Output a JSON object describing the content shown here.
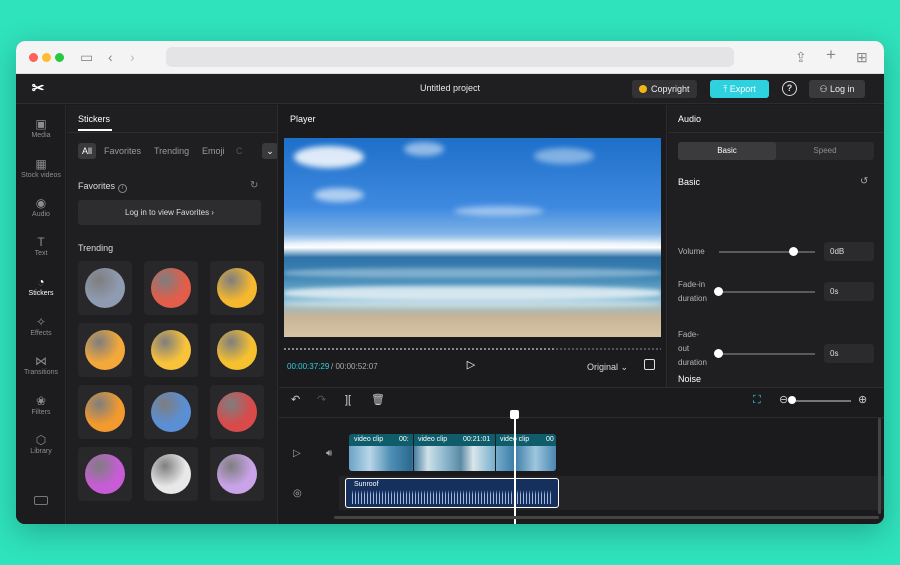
{
  "app": {
    "project_title": "Untitled project",
    "copyright_label": "Copyright",
    "export_label": "Export",
    "login_label": "Log in",
    "help_glyph": "?"
  },
  "nav": {
    "items": [
      {
        "label": "Media",
        "icon": "media-icon"
      },
      {
        "label": "Stock videos",
        "icon": "stock-videos-icon"
      },
      {
        "label": "Audio",
        "icon": "audio-icon"
      },
      {
        "label": "Text",
        "icon": "text-icon"
      },
      {
        "label": "Stickers",
        "icon": "stickers-icon"
      },
      {
        "label": "Effects",
        "icon": "effects-icon"
      },
      {
        "label": "Transitions",
        "icon": "transitions-icon"
      },
      {
        "label": "Filters",
        "icon": "filters-icon"
      },
      {
        "label": "Library",
        "icon": "library-icon"
      }
    ],
    "active": "Stickers"
  },
  "stickers": {
    "title": "Stickers",
    "tabs": [
      "All",
      "Favorites",
      "Trending",
      "Emoji",
      "C"
    ],
    "favorites_title": "Favorites",
    "favorites_login": "Log in to view Favorites ›",
    "trending_title": "Trending",
    "items": [
      {
        "name": "rain-cloud-sticker",
        "color": "#8e9bb0"
      },
      {
        "name": "angry-cloud-sticker",
        "color": "#e25d4a"
      },
      {
        "name": "smiling-sun-sticker",
        "color": "#f5b82e"
      },
      {
        "name": "heart-eyes-sticker",
        "color": "#f4a83a"
      },
      {
        "name": "laughing-tears-sticker",
        "color": "#f8c23a"
      },
      {
        "name": "winking-tongue-sticker",
        "color": "#f6c12f"
      },
      {
        "name": "angry-face-sticker",
        "color": "#f29a2e"
      },
      {
        "name": "video-window-sticker",
        "color": "#5a8fd6"
      },
      {
        "name": "calendar-hand-sticker",
        "color": "#d94a4a"
      },
      {
        "name": "party-popper-sticker",
        "color": "#c85cd6"
      },
      {
        "name": "megaphone-sticker",
        "color": "#e8e8e8"
      },
      {
        "name": "hearts-sticker",
        "color": "#c9a3e8"
      }
    ]
  },
  "player": {
    "title": "Player",
    "time_current": "00:00:37:29",
    "time_total": "/ 00:00:52:07",
    "progress": 0.72,
    "ratio_label": "Original ⌄"
  },
  "audio": {
    "title": "Audio",
    "tab_basic": "Basic",
    "tab_speed": "Speed",
    "section_basic": "Basic",
    "volume_label": "Volume",
    "volume_value": "0dB",
    "volume_level": 0.77,
    "fadein_label": "Fade-in duration",
    "fadein_value": "0s",
    "fadeout_label": "Fade-out duration",
    "fadeout_value": "0s",
    "section_noise": "Noise"
  },
  "timeline": {
    "video_clips": [
      {
        "label": "video clip",
        "time": "00:"
      },
      {
        "label": "video clip",
        "time": "00:21:01"
      },
      {
        "label": "video clip",
        "time": "00"
      }
    ],
    "audio_clip": "Sunroof"
  }
}
